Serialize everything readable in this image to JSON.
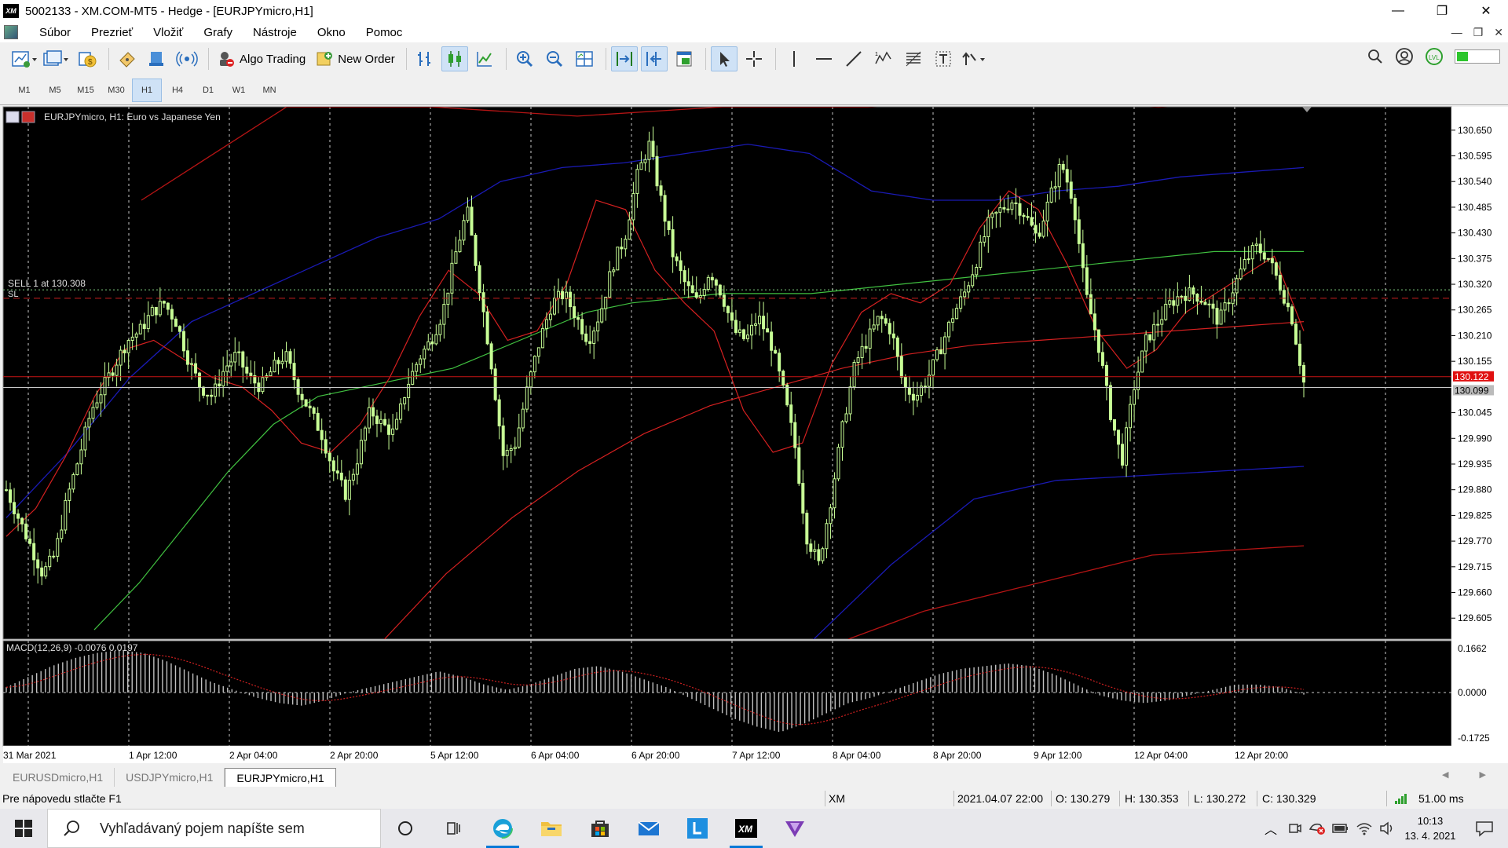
{
  "window": {
    "title": "5002133 - XM.COM-MT5 - Hedge - [EURJPYmicro,H1]",
    "logo_text": "XM",
    "controls": [
      "—",
      "❐",
      "✕"
    ]
  },
  "menu": {
    "items": [
      "Súbor",
      "Prezrieť",
      "Vložiť",
      "Grafy",
      "Nástroje",
      "Okno",
      "Pomoc"
    ],
    "mdi_controls": [
      "—",
      "❐",
      "✕"
    ]
  },
  "toolbar": {
    "algo_trading_label": "Algo Trading",
    "new_order_label": "New Order"
  },
  "timeframes": {
    "items": [
      "M1",
      "M5",
      "M15",
      "M30",
      "H1",
      "H4",
      "D1",
      "W1",
      "MN"
    ],
    "active": "H1"
  },
  "colors": {
    "chart_bg": "#000000",
    "grid": "#c8c8c8",
    "candle": "#c8ff96",
    "ma_red": "#d42020",
    "ma_green": "#40c040",
    "bb_blue": "#1a1ab4",
    "bb_red": "#b41414",
    "sell_line": "#7fcf7f",
    "sl_line": "#c82020",
    "ask_line": "#c81414",
    "bid_line": "#c8c8c8",
    "macd_hist": "#c0c0c0",
    "macd_signal": "#d02020"
  },
  "chart": {
    "header": "EURJPYmicro, H1:  Euro vs Japanese Yen",
    "sell_label": "SELL 1 at 130.308",
    "sl_label": "SL",
    "price_ticks": [
      "130.650",
      "130.595",
      "130.540",
      "130.485",
      "130.430",
      "130.375",
      "130.320",
      "130.265",
      "130.210",
      "130.155",
      "130.045",
      "129.990",
      "129.935",
      "129.880",
      "129.825",
      "129.770",
      "129.715",
      "129.660",
      "129.605"
    ],
    "ask_label": "130.122",
    "bid_label": "130.099",
    "time_labels": [
      "31 Mar 2021",
      "1 Apr 12:00",
      "2 Apr 04:00",
      "2 Apr 20:00",
      "5 Apr 12:00",
      "6 Apr 04:00",
      "6 Apr 20:00",
      "7 Apr 12:00",
      "8 Apr 04:00",
      "8 Apr 20:00",
      "9 Apr 12:00",
      "12 Apr 04:00",
      "12 Apr 20:00"
    ],
    "macd_header": "MACD(12,26,9) -0.0076 0.0197",
    "macd_ticks": [
      "0.1662",
      "0.0000",
      "-0.1725"
    ]
  },
  "chart_data": {
    "type": "candlestick",
    "symbol": "EURJPYmicro",
    "timeframe": "H1",
    "ylim": [
      129.56,
      130.69
    ],
    "sell_price": 130.308,
    "sl_price": 130.29,
    "ask": 130.122,
    "bid": 130.099,
    "close_path": [
      129.88,
      129.82,
      129.76,
      129.7,
      129.74,
      129.86,
      129.95,
      130.05,
      130.1,
      130.15,
      130.2,
      130.22,
      130.26,
      130.28,
      130.24,
      130.16,
      130.1,
      130.08,
      130.14,
      130.17,
      130.12,
      130.1,
      130.14,
      130.17,
      130.1,
      130.05,
      130.0,
      129.92,
      129.87,
      129.95,
      130.05,
      130.02,
      130.0,
      130.1,
      130.16,
      130.2,
      130.26,
      130.38,
      130.48,
      130.32,
      130.15,
      129.95,
      129.98,
      130.1,
      130.2,
      130.28,
      130.3,
      130.25,
      130.2,
      130.26,
      130.36,
      130.42,
      130.55,
      130.62,
      130.5,
      130.38,
      130.32,
      130.28,
      130.35,
      130.3,
      130.22,
      130.2,
      130.25,
      130.2,
      130.1,
      129.98,
      129.78,
      129.72,
      129.86,
      130.02,
      130.15,
      130.2,
      130.25,
      130.22,
      130.1,
      130.08,
      130.12,
      130.18,
      130.25,
      130.3,
      130.37,
      130.45,
      130.48,
      130.5,
      130.47,
      130.42,
      130.5,
      130.58,
      130.5,
      130.3,
      130.2,
      130.05,
      129.94,
      130.1,
      130.2,
      130.24,
      130.28,
      130.3,
      130.3,
      130.28,
      130.24,
      130.3,
      130.36,
      130.4,
      130.38,
      130.32,
      130.25,
      130.11
    ],
    "ma_fast_path": [
      129.78,
      129.84,
      129.95,
      130.08,
      130.18,
      130.2,
      130.16,
      130.12,
      130.1,
      130.05,
      129.98,
      129.96,
      130.02,
      130.12,
      130.25,
      130.35,
      130.3,
      130.2,
      130.22,
      130.32,
      130.5,
      130.48,
      130.35,
      130.28,
      130.22,
      130.05,
      129.96,
      129.98,
      130.15,
      130.26,
      130.3,
      130.28,
      130.32,
      130.44,
      130.52,
      130.48,
      130.36,
      130.22,
      130.14,
      130.18,
      130.26,
      130.3,
      130.34,
      130.38,
      130.22
    ],
    "ma_mid_path": [
      129.58,
      129.68,
      129.8,
      129.92,
      130.02,
      130.08,
      130.1,
      130.12,
      130.14,
      130.18,
      130.22,
      130.26,
      130.28,
      130.29,
      130.3,
      130.3,
      130.3,
      130.31,
      130.32,
      130.33,
      130.34,
      130.35,
      130.36,
      130.37,
      130.38,
      130.39,
      130.39,
      130.39
    ],
    "ma_slow_path": [
      129.4,
      129.55,
      129.7,
      129.82,
      129.92,
      130.0,
      130.06,
      130.1,
      130.14,
      130.17,
      130.19,
      130.2,
      130.21,
      130.22,
      130.23,
      130.24
    ],
    "bb_upper_blue": [
      129.82,
      129.96,
      130.12,
      130.24,
      130.3,
      130.36,
      130.42,
      130.46,
      130.54,
      130.57,
      130.58,
      130.6,
      130.62,
      130.6,
      130.52,
      130.5,
      130.5,
      130.52,
      130.53,
      130.55,
      130.56,
      130.57
    ],
    "bb_lower_blue": [
      129.55,
      129.72,
      129.86,
      129.9,
      129.91,
      129.92,
      129.93
    ],
    "bb_upper_red": [
      130.5,
      130.7,
      130.7,
      130.68,
      130.7,
      130.7,
      130.72,
      130.7,
      130.72
    ],
    "bb_lower_red": [
      129.56,
      129.62,
      129.66,
      129.7,
      129.74,
      129.75,
      129.76
    ],
    "macd_hist_path": [
      0.02,
      0.06,
      0.1,
      0.13,
      0.15,
      0.16,
      0.15,
      0.12,
      0.08,
      0.04,
      0.01,
      -0.02,
      -0.04,
      -0.05,
      -0.03,
      0.0,
      0.02,
      0.04,
      0.06,
      0.08,
      0.06,
      0.03,
      0.01,
      0.03,
      0.06,
      0.09,
      0.1,
      0.08,
      0.05,
      0.02,
      -0.02,
      -0.06,
      -0.1,
      -0.13,
      -0.15,
      -0.12,
      -0.08,
      -0.04,
      -0.02,
      0.01,
      0.04,
      0.07,
      0.09,
      0.1,
      0.11,
      0.1,
      0.07,
      0.03,
      -0.01,
      -0.03,
      -0.04,
      -0.03,
      -0.01,
      0.01,
      0.03,
      0.03,
      0.02,
      -0.008
    ]
  },
  "tabs": {
    "items": [
      "EURUSDmicro,H1",
      "USDJPYmicro,H1",
      "EURJPYmicro,H1"
    ],
    "active_index": 2,
    "arrows": "◀ ▶"
  },
  "status": {
    "help": "Pre nápovedu stlačte F1",
    "broker": "XM",
    "datetime": "2021.04.07 22:00",
    "open": "O: 130.279",
    "high": "H: 130.353",
    "low": "L: 130.272",
    "close": "C: 130.329",
    "ping": "51.00 ms"
  },
  "taskbar": {
    "search_placeholder": "Vyhľadávaný pojem napíšte sem",
    "time": "10:13",
    "date": "13. 4. 2021",
    "apps": [
      "cortana-icon",
      "task-view-icon",
      "edge-icon",
      "explorer-icon",
      "store-icon",
      "mail-icon",
      "l-app-icon",
      "xm-app-icon",
      "purple-app-icon"
    ]
  }
}
